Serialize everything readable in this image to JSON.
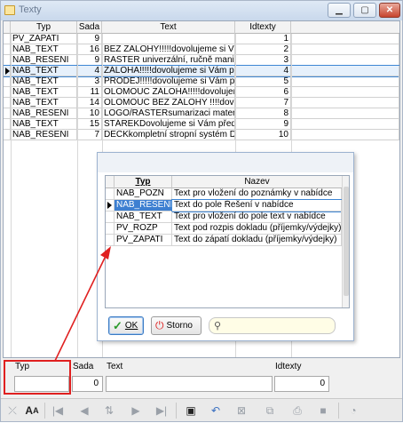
{
  "window": {
    "title": "Texty"
  },
  "grid": {
    "headers": [
      "Typ",
      "Sada",
      "Text",
      "Idtexty"
    ],
    "rows": [
      {
        "typ": "PV_ZAPATI",
        "sada": "9",
        "text": "",
        "id": "1"
      },
      {
        "typ": "NAB_TEXT",
        "sada": "16",
        "text": "BEZ ZALOHY!!!!!dovolujeme si Vám p",
        "id": "2"
      },
      {
        "typ": "NAB_RESENI",
        "sada": "9",
        "text": "RASTER univerzální, ručně manipul",
        "id": "3"
      },
      {
        "typ": "NAB_TEXT",
        "sada": "4",
        "text": "ZÁLOHA!!!!!dovolujeme si Vám předlo",
        "id": "4"
      },
      {
        "typ": "NAB_TEXT",
        "sada": "3",
        "text": "PRODEJ!!!!!dovolujeme si Vám předl",
        "id": "5"
      },
      {
        "typ": "NAB_TEXT",
        "sada": "11",
        "text": "OLOMOUC ZÁLOHA!!!!!dovolujeme s",
        "id": "6"
      },
      {
        "typ": "NAB_TEXT",
        "sada": "14",
        "text": "OLOMOUC BEZ ZÁLOHY !!!!dovolujem",
        "id": "7"
      },
      {
        "typ": "NAB_RESENI",
        "sada": "10",
        "text": "LOGO/RASTERsumarizaci materiálu",
        "id": "8"
      },
      {
        "typ": "NAB_TEXT",
        "sada": "15",
        "text": "STÁREKDovolujeme si Vám předlož",
        "id": "9"
      },
      {
        "typ": "NAB_RESENI",
        "sada": "7",
        "text": "DECKkompletní stropní systém DEC",
        "id": "10"
      }
    ],
    "selected_index": 3
  },
  "lookup": {
    "headers": [
      "Typ",
      "Nazev"
    ],
    "rows": [
      {
        "typ": "NAB_POZN",
        "nazev": "Text pro vložení do poznámky v nabídce"
      },
      {
        "typ": "NAB_RESENI",
        "nazev": "Text do pole Řešení v nabídce"
      },
      {
        "typ": "NAB_TEXT",
        "nazev": "Text pro vložení do pole text v nabídce"
      },
      {
        "typ": "PV_ROZP",
        "nazev": "Text pod rozpis dokladu (příjemky/výdejky)"
      },
      {
        "typ": "PV_ZAPATI",
        "nazev": "Text do zápatí dokladu (příjemky/výdejky)"
      }
    ],
    "selected_index": 1,
    "ok_label": "OK",
    "storno_label": "Storno",
    "search_value": ""
  },
  "editor": {
    "typ_label": "Typ",
    "sada_label": "Sada",
    "text_label": "Text",
    "idtexty_label": "Idtexty",
    "typ_value": "",
    "sada_value": "0",
    "text_value": "",
    "idtexty_value": "0"
  },
  "colors": {
    "accent": "#3d7fd1",
    "annotation": "#e02020",
    "search_bg": "#fffde6"
  },
  "toolbar": {
    "icons": [
      "x-icon",
      "font-icon",
      "first-icon",
      "prev-icon",
      "sort-icon",
      "next-icon",
      "last-icon",
      "save-icon",
      "undo-icon",
      "cancel-icon",
      "copy-icon",
      "print-icon",
      "stop-icon",
      "clock-icon"
    ]
  }
}
